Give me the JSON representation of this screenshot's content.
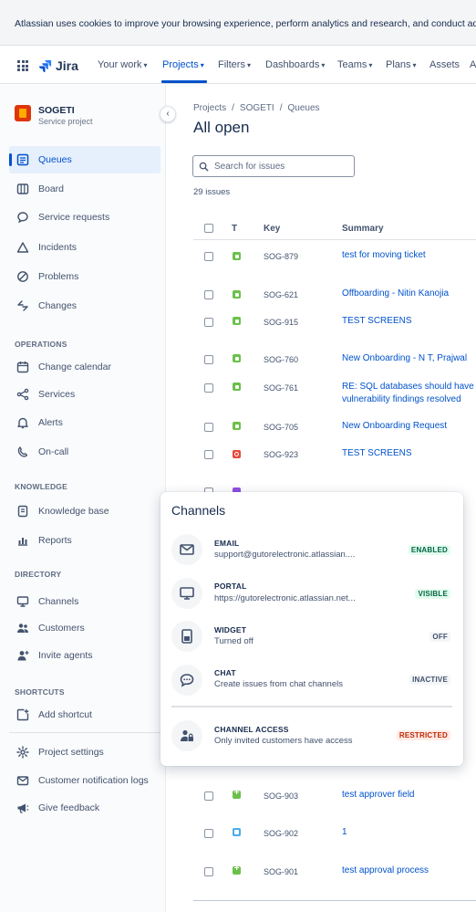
{
  "cookie_banner": {
    "text": "Atlassian uses cookies to improve your browsing experience, perform analytics and research, and conduct adve"
  },
  "topnav": {
    "product": "Jira",
    "items": [
      "Your work",
      "Projects",
      "Filters",
      "Dashboards",
      "Teams",
      "Plans",
      "Assets",
      "A"
    ],
    "active": "Projects"
  },
  "sidebar": {
    "project_name": "SOGETI",
    "project_type": "Service project",
    "items": [
      {
        "label": "Queues",
        "icon": "queues-icon"
      },
      {
        "label": "Board",
        "icon": "board-icon"
      },
      {
        "label": "Service requests",
        "icon": "service-requests-icon"
      },
      {
        "label": "Incidents",
        "icon": "incidents-icon"
      },
      {
        "label": "Problems",
        "icon": "problems-icon"
      },
      {
        "label": "Changes",
        "icon": "changes-icon"
      }
    ],
    "operations_heading": "OPERATIONS",
    "operations": [
      {
        "label": "Change calendar",
        "icon": "calendar-icon"
      },
      {
        "label": "Services",
        "icon": "services-icon"
      },
      {
        "label": "Alerts",
        "icon": "alerts-icon"
      },
      {
        "label": "On-call",
        "icon": "on-call-icon"
      }
    ],
    "knowledge_heading": "KNOWLEDGE",
    "knowledge": [
      {
        "label": "Knowledge base",
        "icon": "knowledge-base-icon"
      },
      {
        "label": "Reports",
        "icon": "reports-icon"
      }
    ],
    "directory_heading": "DIRECTORY",
    "directory": [
      {
        "label": "Channels",
        "icon": "channels-icon"
      },
      {
        "label": "Customers",
        "icon": "customers-icon"
      },
      {
        "label": "Invite agents",
        "icon": "invite-agents-icon"
      }
    ],
    "shortcuts_heading": "SHORTCUTS",
    "shortcuts": [
      {
        "label": "Add shortcut",
        "icon": "add-shortcut-icon"
      }
    ],
    "footer": [
      {
        "label": "Project settings",
        "icon": "settings-icon"
      },
      {
        "label": "Customer notification logs",
        "icon": "notification-logs-icon"
      },
      {
        "label": "Give feedback",
        "icon": "feedback-icon"
      }
    ]
  },
  "main": {
    "breadcrumbs": [
      "Projects",
      "SOGETI",
      "Queues"
    ],
    "title": "All open",
    "search_placeholder": "Search for issues",
    "issue_count": "29 issues",
    "columns": {
      "type": "T",
      "key": "Key",
      "summary": "Summary"
    },
    "issues": [
      {
        "key": "SOG-879",
        "type": "green",
        "summary": "test for moving ticket"
      },
      {
        "key": "SOG-621",
        "type": "green",
        "summary": "Offboarding - Nitin Kanojia"
      },
      {
        "key": "SOG-915",
        "type": "green",
        "summary": "TEST SCREENS"
      },
      {
        "key": "SOG-760",
        "type": "green",
        "summary": "New Onboarding - N T, Prajwal"
      },
      {
        "key": "SOG-761",
        "type": "green",
        "summary": "RE: SQL databases should have",
        "summary2": "vulnerability findings resolved"
      },
      {
        "key": "SOG-705",
        "type": "green",
        "summary": "New Onboarding Request"
      },
      {
        "key": "SOG-923",
        "type": "red",
        "summary": "TEST SCREENS"
      },
      {
        "key": "SOG-903",
        "type": "plus",
        "summary": "test approver field"
      },
      {
        "key": "SOG-902",
        "type": "blue",
        "summary": "1"
      },
      {
        "key": "SOG-901",
        "type": "plus",
        "summary": "test approval process"
      }
    ]
  },
  "channels_popup": {
    "title": "Channels",
    "channels": [
      {
        "title": "EMAIL",
        "desc": "support@gutorelectronic.atlassian....",
        "status": "ENABLED",
        "status_color": "green",
        "icon": "email-icon"
      },
      {
        "title": "PORTAL",
        "desc": "https://gutorelectronic.atlassian.net...",
        "status": "VISIBLE",
        "status_color": "green",
        "icon": "portal-icon"
      },
      {
        "title": "WIDGET",
        "desc": "Turned off",
        "status": "OFF",
        "status_color": "grey",
        "icon": "widget-icon"
      },
      {
        "title": "CHAT",
        "desc": "Create issues from chat channels",
        "status": "INACTIVE",
        "status_color": "grey",
        "icon": "chat-icon"
      }
    ],
    "access": {
      "title": "CHANNEL ACCESS",
      "desc": "Only invited customers have access",
      "status": "RESTRICTED",
      "status_color": "red",
      "icon": "channel-access-icon"
    }
  },
  "colors": {
    "accent": "#0052cc",
    "sidebar_active_bg": "#e6effc",
    "enabled": "#006644",
    "restricted": "#bf2600"
  }
}
